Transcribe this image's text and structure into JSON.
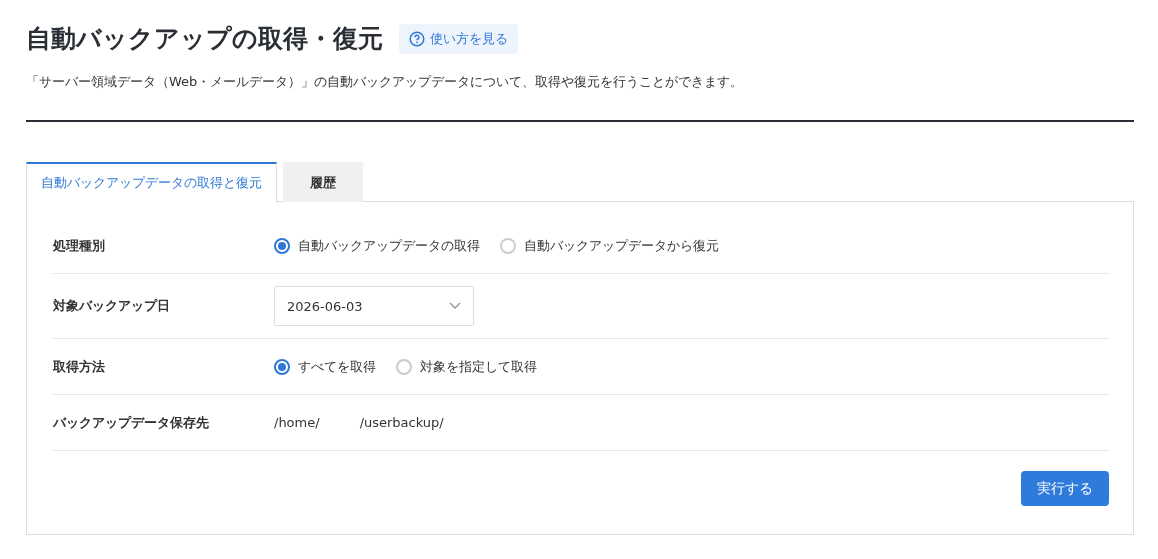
{
  "header": {
    "title": "自動バックアップの取得・復元",
    "help_link": "使い方を見る",
    "description": "「サーバー領域データ（Web・メールデータ）」の自動バックアップデータについて、取得や復元を行うことができます。"
  },
  "tabs": [
    {
      "label": "自動バックアップデータの取得と復元",
      "selected": true
    },
    {
      "label": "履歴",
      "selected": false
    }
  ],
  "form": {
    "rows": [
      {
        "kind": "radio",
        "label": "処理種別",
        "options": [
          {
            "label": "自動バックアップデータの取得",
            "selected": true
          },
          {
            "label": "自動バックアップデータから復元",
            "selected": false
          }
        ]
      },
      {
        "kind": "select",
        "label": "対象バックアップ日",
        "value": "2026-06-03"
      },
      {
        "kind": "radio",
        "label": "取得方法",
        "options": [
          {
            "label": "すべてを取得",
            "selected": true
          },
          {
            "label": "対象を指定して取得",
            "selected": false
          }
        ]
      },
      {
        "kind": "path",
        "label": "バックアップデータ保存先",
        "parts": [
          "/home/",
          "/userbackup/"
        ]
      }
    ],
    "submit_button": "実行する"
  }
}
